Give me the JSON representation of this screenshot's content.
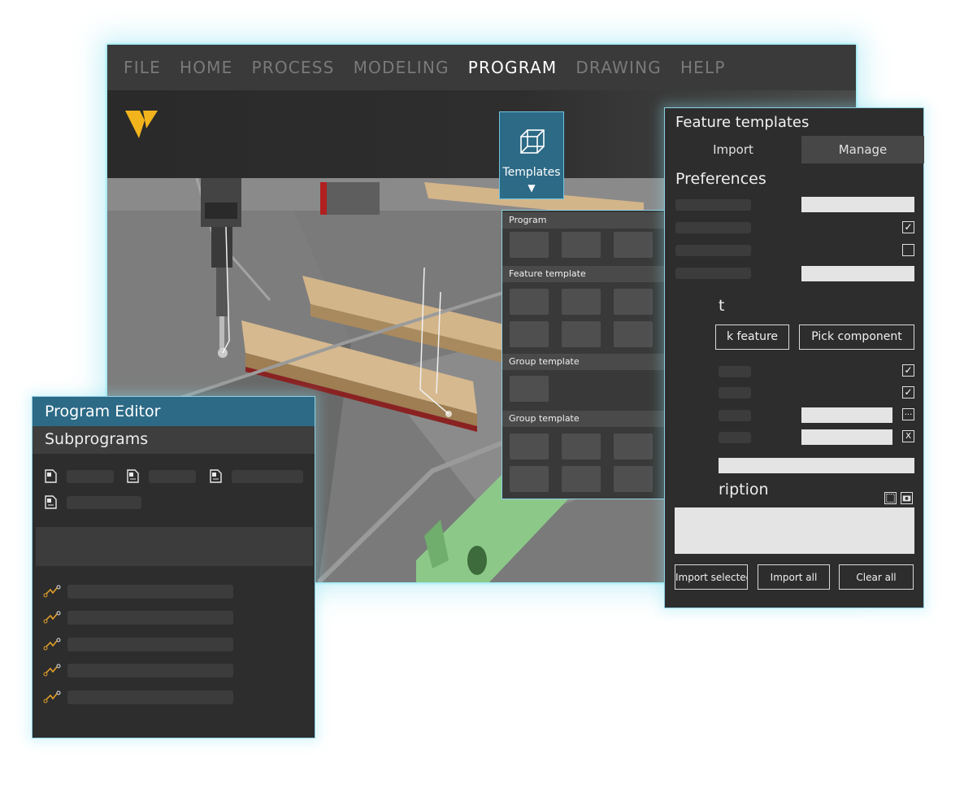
{
  "menu": {
    "items": [
      {
        "label": "FILE"
      },
      {
        "label": "HOME"
      },
      {
        "label": "PROCESS"
      },
      {
        "label": "MODELING"
      },
      {
        "label": "PROGRAM",
        "active": true
      },
      {
        "label": "DRAWING"
      },
      {
        "label": "HELP"
      }
    ]
  },
  "ribbon": {
    "templates_button": {
      "label": "Templates",
      "caret": "▼",
      "icon": "wireframe-cube-icon"
    },
    "logo_icon": "v-logo-icon"
  },
  "templates_dropdown": {
    "sections": [
      {
        "title": "Program"
      },
      {
        "title": "Feature template"
      },
      {
        "title": "Group template"
      },
      {
        "title": "Group template"
      }
    ]
  },
  "feature_panel": {
    "title": "Feature templates",
    "tabs": [
      {
        "label": "Import",
        "active": true
      },
      {
        "label": "Manage",
        "active": false
      }
    ],
    "preferences_heading": "Preferences",
    "import_heading": "t",
    "pick_feature_label": "k feature",
    "pick_component_label": "Pick component",
    "description_heading": "ription",
    "ellipsis_label": "...",
    "clear_x_label": "X",
    "checkbox_checked": "✓",
    "buttons": {
      "import_selected": "Import selectec",
      "import_all": "Import all",
      "clear_all": "Clear all"
    }
  },
  "program_editor": {
    "title": "Program Editor",
    "subtitle": "Subprograms",
    "subprogram_icons": [
      "subprogram-m-icon",
      "subprogram-s-icon",
      "subprogram-s-icon",
      "subprogram-s-icon"
    ],
    "path_icon": "weld-path-icon"
  },
  "colors": {
    "accent_blue": "#2c6a86",
    "logo_yellow": "#f2b41c",
    "path_orange": "#e8a22a",
    "glow": "#8fcfe2"
  }
}
